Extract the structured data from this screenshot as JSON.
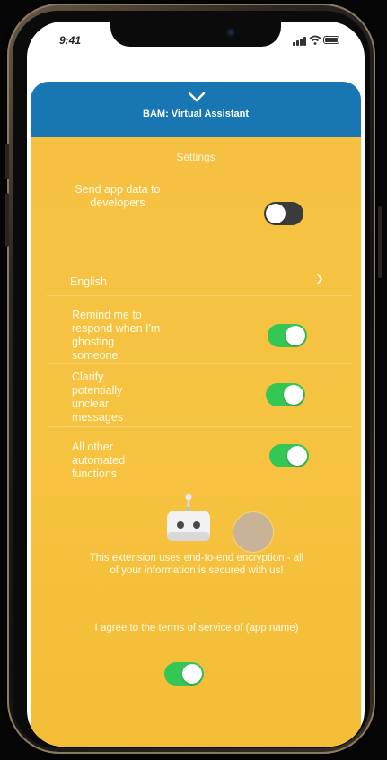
{
  "status_bar": {
    "time": "9:41"
  },
  "sheet": {
    "title": "BAM: Virtual Assistant",
    "header_color": "#1877b3",
    "body_color": "#f6c142",
    "collapse_icon": "chevron-down-icon"
  },
  "settings": {
    "title": "Settings",
    "send_app_data": {
      "label": "Send app data to developers",
      "enabled": false
    },
    "language": {
      "label": "English",
      "icon": "chevron-right-icon"
    },
    "remind_ghosting": {
      "label": "Remind me to respond when I'm ghosting someone",
      "enabled": true
    },
    "clarify_messages": {
      "label": "Clarify potentially unclear messages",
      "enabled": true
    },
    "automated_functions": {
      "label": "All other automated functions",
      "enabled": true
    }
  },
  "info": {
    "encryption_text": "This extension uses end-to-end encryption - all of your information is secured with us!",
    "robot_icon": "robot-icon"
  },
  "terms": {
    "label": "I agree to the terms of service of (app name)",
    "enabled": true
  },
  "colors": {
    "toggle_on": "#35c755",
    "toggle_off": "#3b3b3b"
  }
}
